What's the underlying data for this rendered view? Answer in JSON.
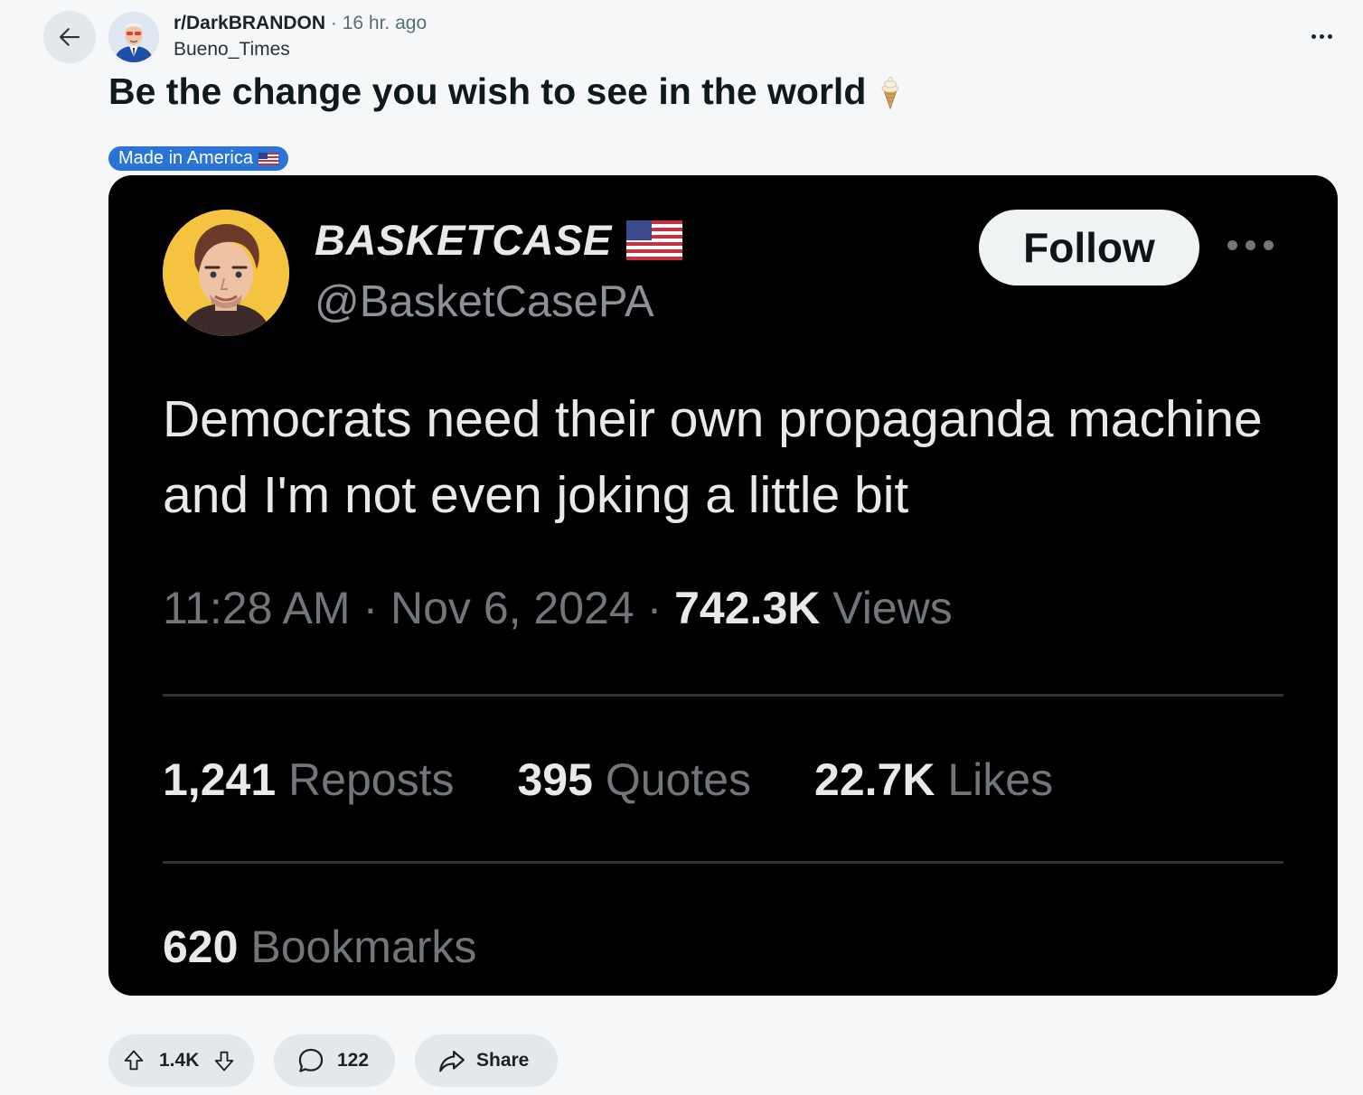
{
  "post": {
    "subreddit": "r/DarkBRANDON",
    "separator": "·",
    "time": "16 hr. ago",
    "author": "Bueno_Times",
    "title": "Be the change you wish to see in the world",
    "title_emoji": "soft-ice-cream",
    "flair": "Made in America",
    "flair_color": "#2a74d6"
  },
  "tweet": {
    "display_name": "BASKETCASE",
    "handle": "@BasketCasePA",
    "follow_label": "Follow",
    "text": "Democrats need their own propaganda machine and I'm not even joking a little bit",
    "time": "11:28 AM",
    "date": "Nov 6, 2024",
    "dot": "·",
    "views_count": "742.3K",
    "views_label": "Views",
    "reposts_count": "1,241",
    "reposts_label": "Reposts",
    "quotes_count": "395",
    "quotes_label": "Quotes",
    "likes_count": "22.7K",
    "likes_label": "Likes",
    "bookmarks_count": "620",
    "bookmarks_label": "Bookmarks"
  },
  "actions": {
    "votes": "1.4K",
    "comments": "122",
    "share_label": "Share"
  },
  "icons": {
    "back": "arrow-left-icon",
    "more": "ellipsis-icon",
    "upvote": "upvote-arrow-icon",
    "downvote": "downvote-arrow-icon",
    "comment": "speech-bubble-icon",
    "share": "share-arrow-icon",
    "flag": "us-flag-icon"
  }
}
